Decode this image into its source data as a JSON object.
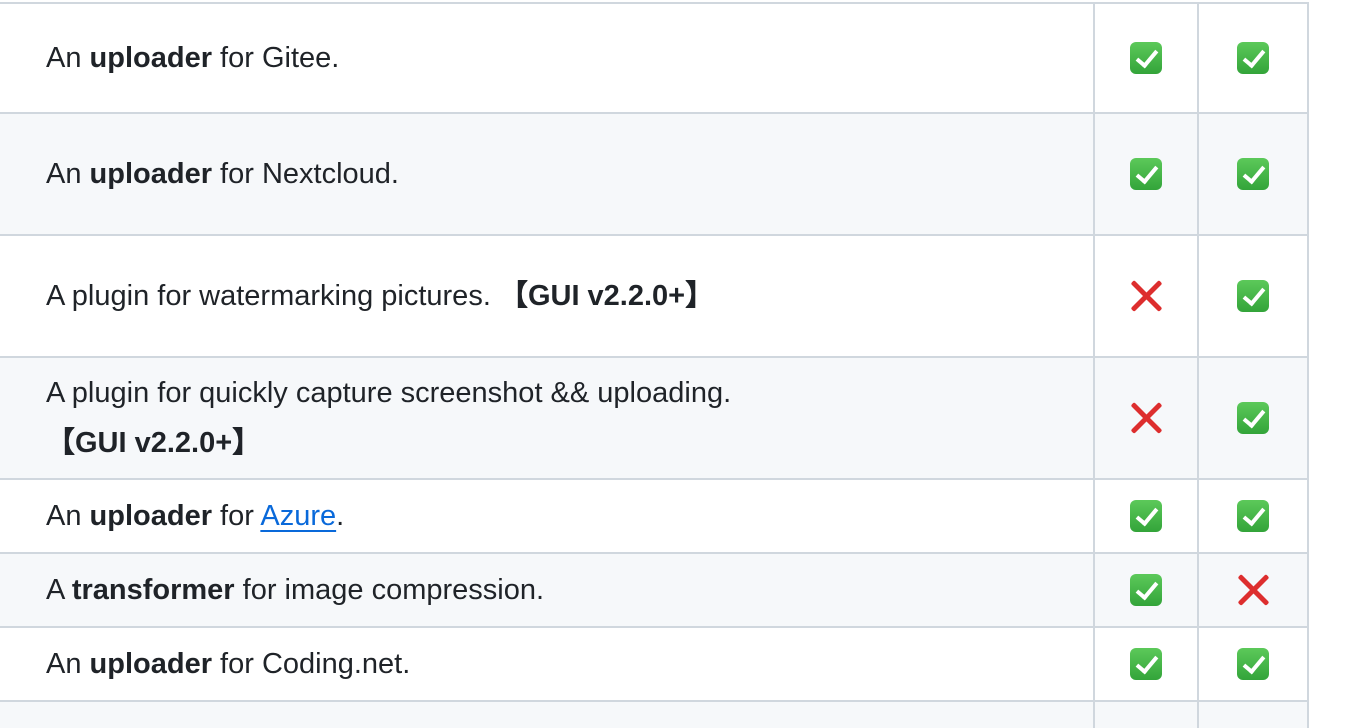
{
  "rows": [
    {
      "description": [
        {
          "text": "An ",
          "bold": false
        },
        {
          "text": "uploader",
          "bold": true
        },
        {
          "text": " for Gitee.",
          "bold": false
        }
      ],
      "col1": "check",
      "col2": "check"
    },
    {
      "description": [
        {
          "text": "An ",
          "bold": false
        },
        {
          "text": "uploader",
          "bold": true
        },
        {
          "text": " for Nextcloud.",
          "bold": false
        }
      ],
      "col1": "check",
      "col2": "check"
    },
    {
      "description": [
        {
          "text": "A plugin for watermarking pictures. ",
          "bold": false
        },
        {
          "text": "【GUI v2.2.0+】",
          "bold": true
        }
      ],
      "col1": "cross",
      "col2": "check"
    },
    {
      "description": [
        {
          "text": "A plugin for quickly capture screenshot && uploading. ",
          "bold": false
        },
        {
          "text": "【GUI v2.2.0+】",
          "bold": true
        }
      ],
      "col1": "cross",
      "col2": "check"
    },
    {
      "description": [
        {
          "text": "An ",
          "bold": false
        },
        {
          "text": "uploader",
          "bold": true
        },
        {
          "text": " for ",
          "bold": false
        },
        {
          "text": "Azure",
          "link": true
        },
        {
          "text": ".",
          "bold": false
        }
      ],
      "col1": "check",
      "col2": "check"
    },
    {
      "description": [
        {
          "text": "A ",
          "bold": false
        },
        {
          "text": "transformer",
          "bold": true
        },
        {
          "text": " for image compression.",
          "bold": false
        }
      ],
      "col1": "check",
      "col2": "cross"
    },
    {
      "description": [
        {
          "text": "An ",
          "bold": false
        },
        {
          "text": "uploader",
          "bold": true
        },
        {
          "text": " for Coding.net.",
          "bold": false
        }
      ],
      "col1": "check",
      "col2": "check"
    }
  ],
  "icons": {
    "check": "white-heavy-check-mark-icon",
    "cross": "cross-mark-icon"
  },
  "colors": {
    "border": "#d0d7de",
    "stripe": "#f6f8fa",
    "link": "#0969da",
    "check": "#3fb950",
    "cross": "#dd2e2e"
  }
}
